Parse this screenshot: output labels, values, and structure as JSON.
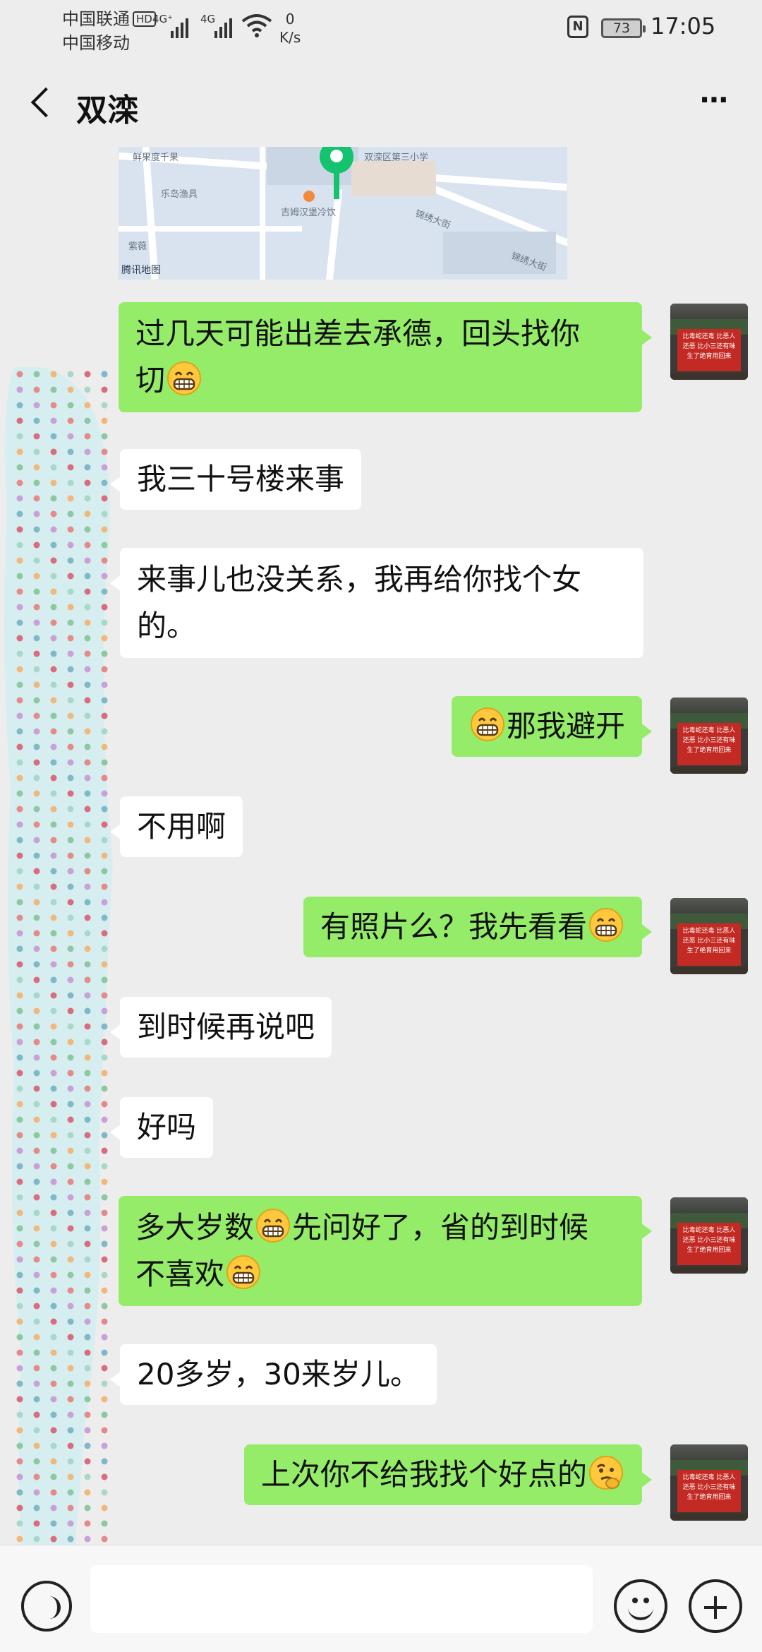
{
  "status_bar": {
    "carrier_1": "中国联通",
    "carrier_badge": "HD",
    "carrier_2": "中国移动",
    "signal_1": "4G⁺",
    "signal_2": "4G",
    "speed_value": "0",
    "speed_unit": "K/s",
    "battery": "73",
    "time": "17:05"
  },
  "header": {
    "title": "双滦",
    "back_icon": "chevron-left-icon",
    "more_label": "⋯"
  },
  "map": {
    "labels": [
      "鲜果度千果",
      "乐岛渔具",
      "吉姆汉堡冷饮",
      "双滦区第三小学",
      "锦绣大街",
      "锦绣大街",
      "紫薇"
    ],
    "logo": "腾讯地图"
  },
  "messages": [
    {
      "side": "out",
      "lines": [
        "过几天可能出差去承德，回头找你",
        "切"
      ],
      "emoji_after": "grin"
    },
    {
      "side": "in",
      "lines": [
        "我三十号楼来事"
      ]
    },
    {
      "side": "in",
      "lines": [
        "来事儿也没关系，我再给你找个女",
        "的。"
      ]
    },
    {
      "side": "out",
      "text": "那我避开",
      "emoji_before": "grin"
    },
    {
      "side": "in",
      "lines": [
        "不用啊"
      ]
    },
    {
      "side": "out",
      "text": "有照片么？我先看看",
      "emoji_after": "grin"
    },
    {
      "side": "in",
      "lines": [
        "到时候再说吧"
      ]
    },
    {
      "side": "in",
      "lines": [
        "好吗"
      ]
    },
    {
      "side": "out",
      "part1": "多大岁数",
      "part2": "先问好了，省的到时候",
      "part3": "不喜欢"
    },
    {
      "side": "in",
      "lines": [
        "20多岁，30来岁儿。"
      ]
    },
    {
      "side": "out",
      "text": "上次你不给我找个好点的",
      "emoji_after": "thinking"
    }
  ],
  "avatar_banner": "比毒蛇还毒 比恶人还恶 比小三还有味 生了绝育用回来",
  "colors": {
    "outgoing_bubble": "#95ec69",
    "incoming_bubble": "#ffffff",
    "background": "#ededed"
  },
  "input_bar": {
    "voice_icon": "voice-icon",
    "emoji_icon": "smiley-icon",
    "plus_icon": "plus-circle-icon"
  }
}
